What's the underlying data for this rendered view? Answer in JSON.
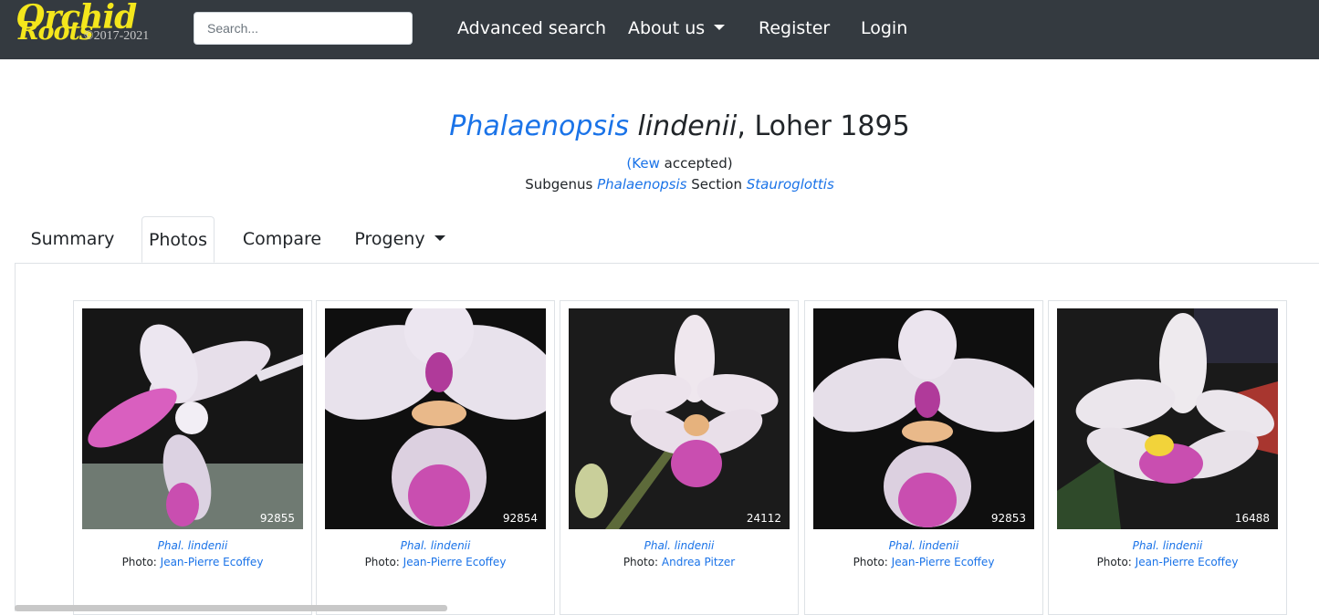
{
  "header": {
    "logo_word1": "Orchid",
    "logo_word2": "Roots",
    "logo_copyright": "©2017-2021",
    "search_placeholder": "Search...",
    "nav": {
      "advanced_search": "Advanced search",
      "about_us": "About us",
      "register": "Register",
      "login": "Login"
    }
  },
  "species": {
    "genus": "Phalaenopsis",
    "epithet": "lindenii",
    "author": ", Loher 1895",
    "status_open": "(",
    "status_link": "Kew",
    "status_text": " accepted)",
    "subgenus_label": "Subgenus ",
    "subgenus": "Phalaenopsis",
    "section_label": " Section ",
    "section": "Stauroglottis"
  },
  "tabs": {
    "summary": "Summary",
    "photos": "Photos",
    "compare": "Compare",
    "progeny": "Progeny"
  },
  "photos": [
    {
      "id": "92855",
      "name": "Phal. lindenii",
      "photo_label": "Photo: ",
      "photographer": "Jean-Pierre Ecoffey"
    },
    {
      "id": "92854",
      "name": "Phal. lindenii",
      "photo_label": "Photo: ",
      "photographer": "Jean-Pierre Ecoffey"
    },
    {
      "id": "24112",
      "name": "Phal. lindenii",
      "photo_label": "Photo: ",
      "photographer": "Andrea Pitzer"
    },
    {
      "id": "92853",
      "name": "Phal. lindenii",
      "photo_label": "Photo: ",
      "photographer": "Jean-Pierre Ecoffey"
    },
    {
      "id": "16488",
      "name": "Phal. lindenii",
      "photo_label": "Photo: ",
      "photographer": "Jean-Pierre Ecoffey"
    }
  ],
  "colors": {
    "navbar_bg": "#343a40",
    "logo_yellow": "#f4e61c",
    "link_blue": "#1a73e8",
    "petal_white": "#efe9f2",
    "lip_magenta": "#c23aa8"
  }
}
